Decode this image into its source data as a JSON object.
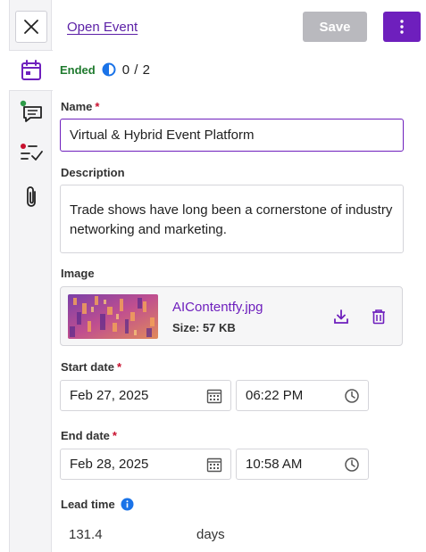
{
  "header": {
    "open_event_link": "Open Event",
    "save_label": "Save"
  },
  "status": {
    "label": "Ended",
    "progress": "0 / 2",
    "progress_fraction": 0.5,
    "color": "#1f7a2e"
  },
  "form": {
    "name": {
      "label": "Name",
      "required_mark": "*",
      "value": "Virtual & Hybrid Event Platform"
    },
    "description": {
      "label": "Description",
      "value": "Trade shows have long been a cornerstone of industry networking and marketing."
    },
    "image": {
      "label": "Image",
      "file_name": "AIContentfy.jpg",
      "size": "Size: 57 KB"
    },
    "start": {
      "label": "Start date",
      "required_mark": "*",
      "date": "Feb 27, 2025",
      "time": "06:22 PM"
    },
    "end": {
      "label": "End date",
      "required_mark": "*",
      "date": "Feb 28, 2025",
      "time": "10:58 AM"
    },
    "lead_time": {
      "label": "Lead time",
      "value": "131.4",
      "unit": "days"
    }
  },
  "icons": {
    "rail": [
      "close-icon",
      "calendar-icon",
      "comments-icon",
      "checklist-icon",
      "paperclip-icon"
    ],
    "image_actions": [
      "download-icon",
      "trash-icon"
    ],
    "field": [
      "calendar-grid-icon",
      "clock-icon",
      "info-icon",
      "kebab-menu-icon",
      "progress-half-circle-icon"
    ]
  },
  "colors": {
    "accent": "#6e1fbd",
    "link": "#5b1fa6",
    "required": "#c8102e",
    "disabled_button": "#b9b9be",
    "info": "#1a73e8"
  }
}
